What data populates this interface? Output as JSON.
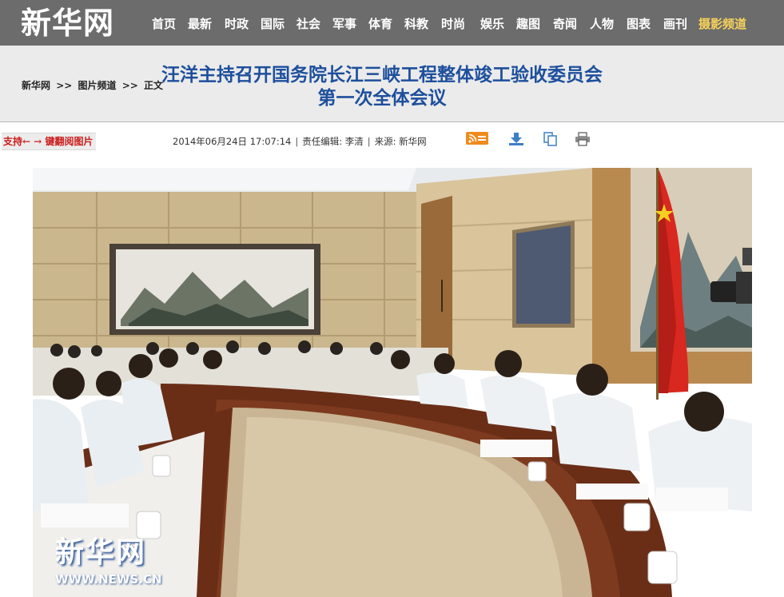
{
  "site": {
    "logo": "新华网"
  },
  "nav": {
    "items": [
      "首页",
      "最新",
      "时政",
      "国际",
      "社会",
      "军事",
      "体育",
      "科教",
      "时尚",
      "娱乐",
      "趣图",
      "奇闻",
      "人物",
      "图表",
      "画刊"
    ],
    "highlight": "摄影频道"
  },
  "breadcrumb": [
    "新华网",
    ">>",
    "图片频道",
    ">>",
    "正文"
  ],
  "article": {
    "title_line1": "汪洋主持召开国务院长江三峡工程整体竣工验收委员会",
    "title_line2": "第一次全体会议",
    "datetime": "2014年06月24日 17:07:14",
    "editor": "责任编辑: 李清",
    "source": "来源:  新华网"
  },
  "key_hint": "支持← → 键翻阅图片",
  "tools": {
    "rss": "rss-icon",
    "download": "download-icon",
    "copy": "copy-icon",
    "print": "print-icon"
  },
  "photo": {
    "watermark_cn": "新华网",
    "watermark_url": "WWW.NEWS.CN"
  },
  "colors": {
    "topbar": "#6c6c6c",
    "headline": "#1d4f9c",
    "nav_highlight": "#f7d25a",
    "key_hint": "#cc1a1a"
  }
}
